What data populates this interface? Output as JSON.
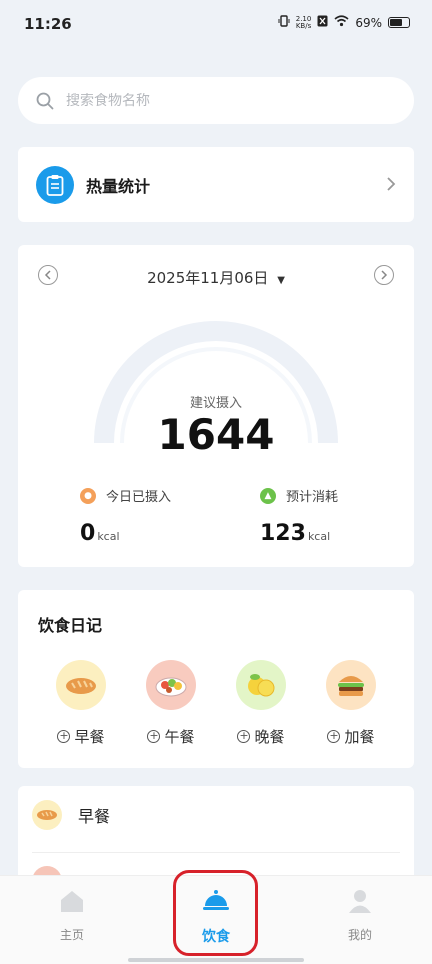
{
  "status_bar": {
    "time": "11:26",
    "speed_top": "2.10",
    "speed_bottom": "KB/s",
    "battery": "69%",
    "battery_level": 0.69
  },
  "search": {
    "placeholder": "搜索食物名称",
    "value": ""
  },
  "stats_card": {
    "title": "热量统计",
    "icon": "clipboard-icon"
  },
  "calendar": {
    "date": "2025年11月06日",
    "suggest_label": "建议摄入",
    "suggest_value": "1644",
    "intake": {
      "label": "今日已摄入",
      "value": "0",
      "unit": "kcal",
      "icon": "bowl-icon"
    },
    "burn": {
      "label": "预计消耗",
      "value": "123",
      "unit": "kcal",
      "icon": "flame-icon"
    },
    "intake_fraction": 0
  },
  "diary": {
    "title": "饮食日记",
    "meals": [
      {
        "label": "早餐",
        "icon": "bread-icon"
      },
      {
        "label": "午餐",
        "icon": "salad-icon"
      },
      {
        "label": "晚餐",
        "icon": "lemon-icon"
      },
      {
        "label": "加餐",
        "icon": "burger-icon"
      }
    ]
  },
  "meal_list": {
    "first": "早餐"
  },
  "tabbar": {
    "tabs": [
      {
        "label": "主页",
        "icon": "home-icon"
      },
      {
        "label": "饮食",
        "icon": "food-cover-icon"
      },
      {
        "label": "我的",
        "icon": "person-icon"
      }
    ],
    "active": "饮食"
  },
  "colors": {
    "accent": "#1a9bea",
    "highlight": "#d7212a",
    "background": "#eef2f7"
  }
}
